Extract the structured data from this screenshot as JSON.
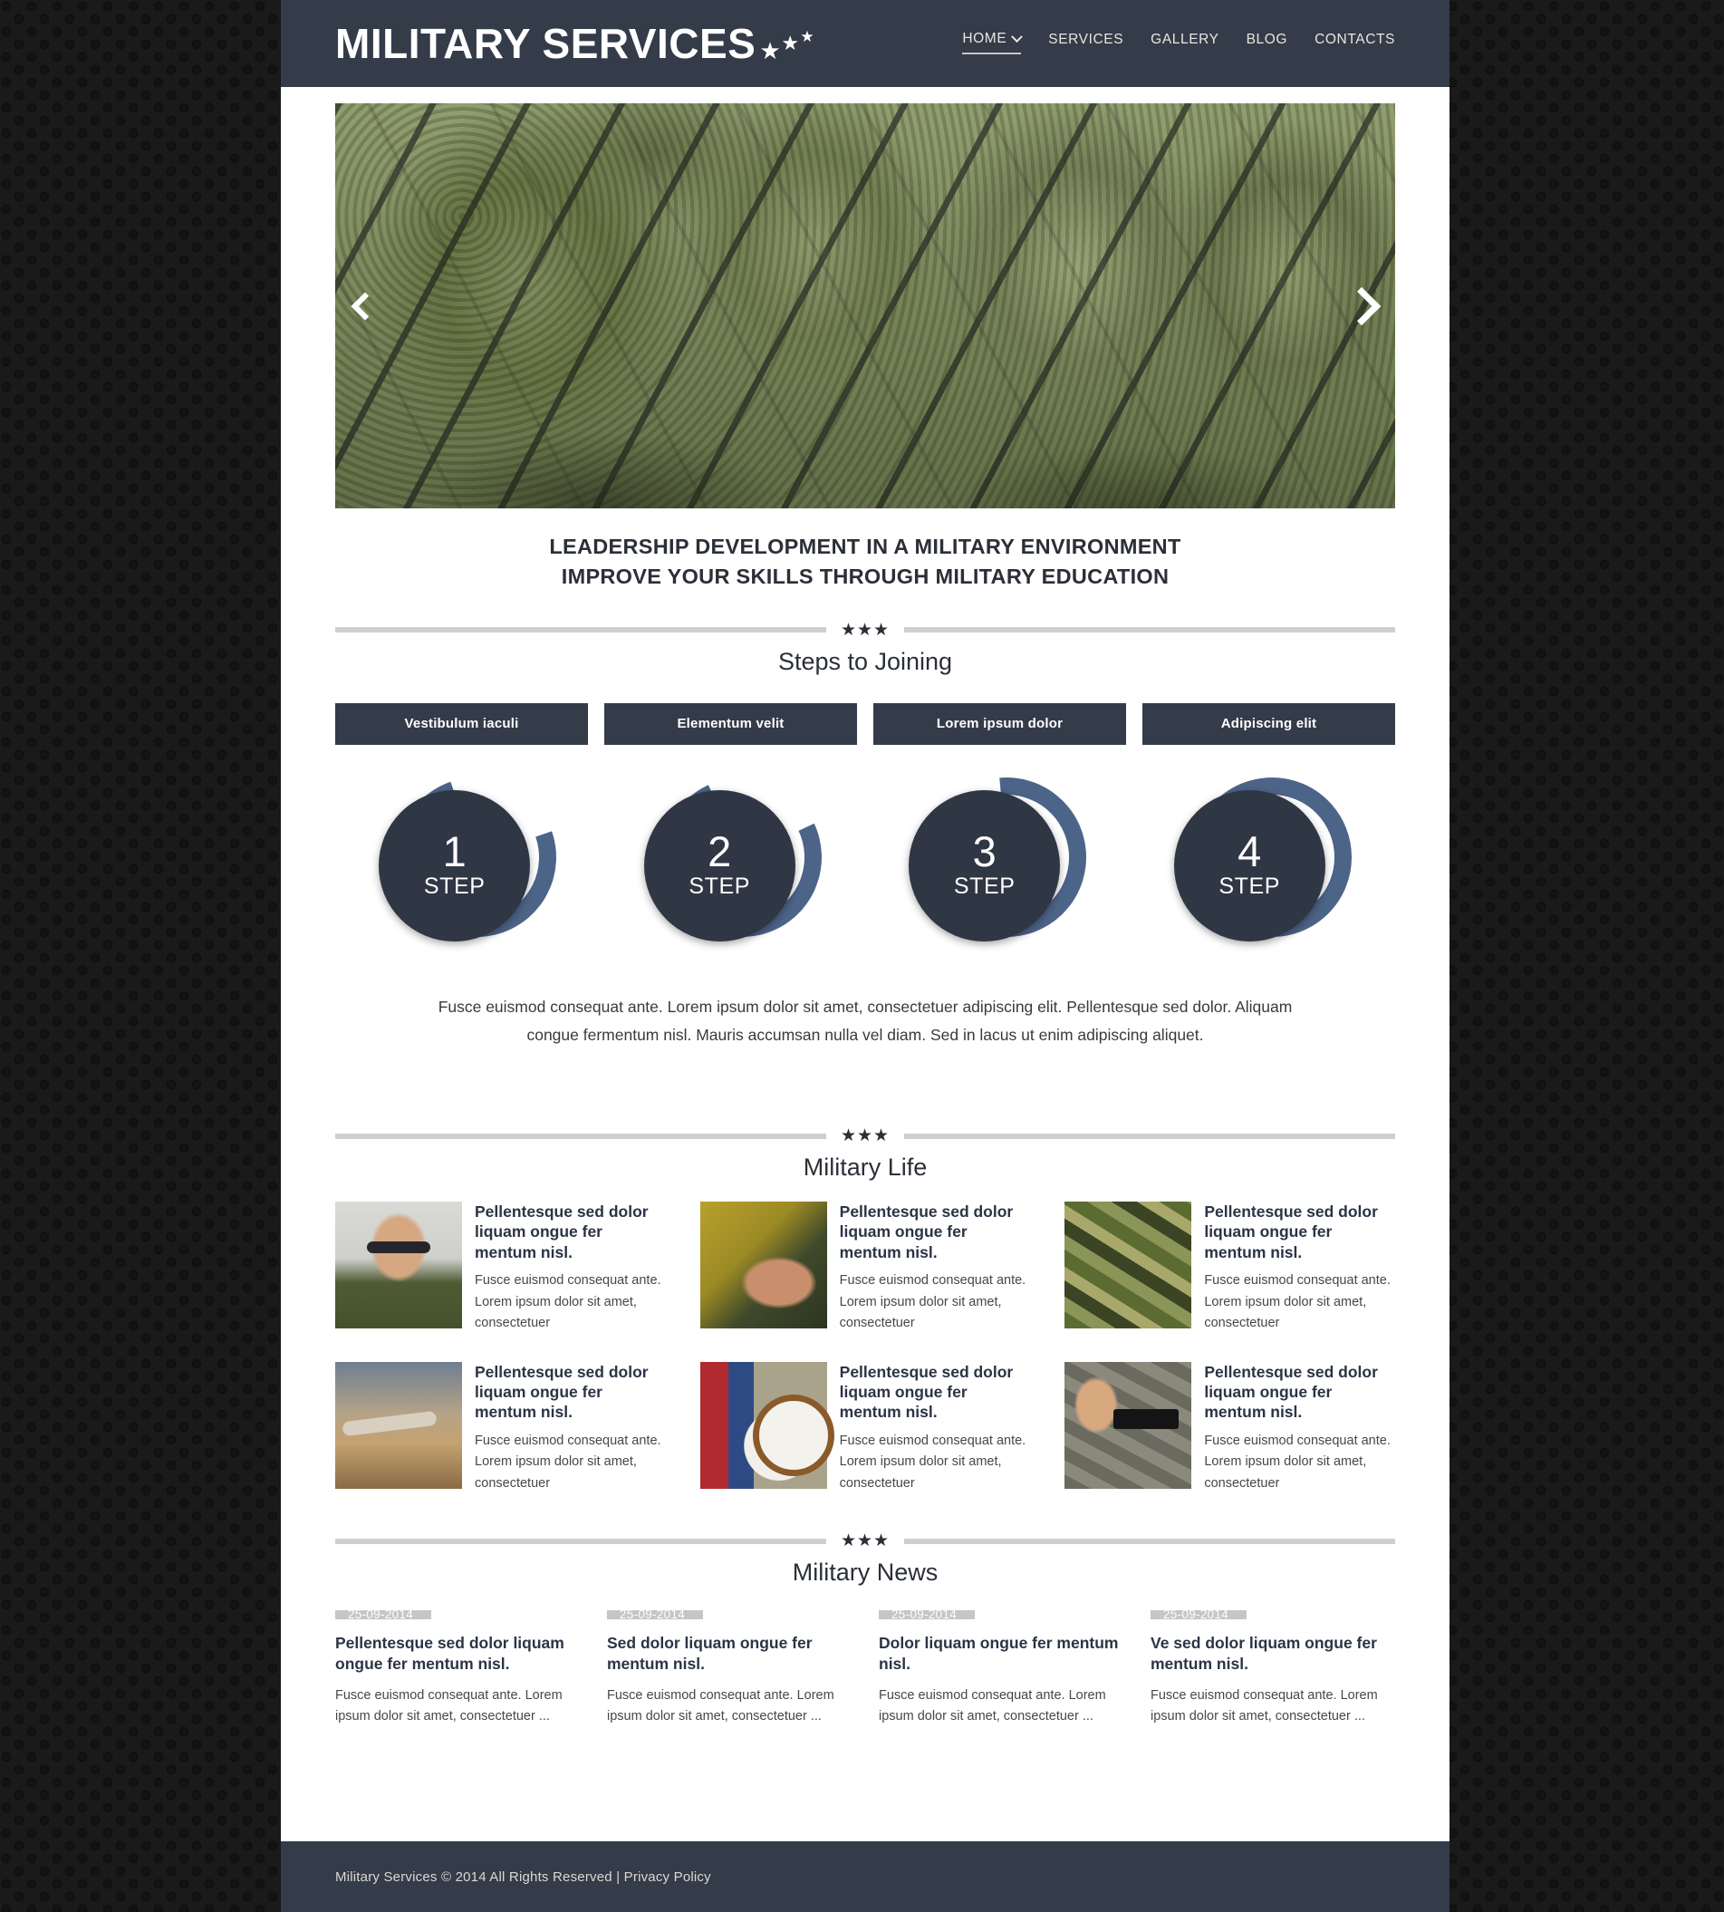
{
  "site": {
    "logo_text": "MILITARY SERVICES",
    "star_glyph": "★"
  },
  "nav": {
    "items": [
      {
        "label": "HOME",
        "active": true,
        "has_dropdown": true
      },
      {
        "label": "SERVICES",
        "active": false,
        "has_dropdown": false
      },
      {
        "label": "GALLERY",
        "active": false,
        "has_dropdown": false
      },
      {
        "label": "BLOG",
        "active": false,
        "has_dropdown": false
      },
      {
        "label": "CONTACTS",
        "active": false,
        "has_dropdown": false
      }
    ]
  },
  "slider": {
    "prev_label": "Previous slide",
    "next_label": "Next slide",
    "image_alt": "Row of soldiers in camouflage helmets holding rifles"
  },
  "tagline": {
    "line1": "LEADERSHIP DEVELOPMENT IN A MILITARY ENVIRONMENT",
    "line2": "IMPROVE YOUR SKILLS THROUGH MILITARY EDUCATION"
  },
  "steps_section": {
    "divider_stars": "★★★",
    "title": "Steps to Joining",
    "tabs": [
      {
        "label": "Vestibulum iaculi"
      },
      {
        "label": "Elementum velit"
      },
      {
        "label": "Lorem ipsum dolor"
      },
      {
        "label": "Adipiscing elit"
      }
    ],
    "circles": [
      {
        "number": "1",
        "label": "STEP"
      },
      {
        "number": "2",
        "label": "STEP"
      },
      {
        "number": "3",
        "label": "STEP"
      },
      {
        "number": "4",
        "label": "STEP"
      }
    ],
    "paragraph": "Fusce euismod consequat ante. Lorem ipsum dolor sit amet, consectetuer adipiscing elit. Pellentesque sed dolor. Aliquam congue fermentum nisl. Mauris accumsan nulla vel diam. Sed in lacus ut enim adipiscing aliquet."
  },
  "life_section": {
    "divider_stars": "★★★",
    "title": "Military Life",
    "items": [
      {
        "title": "Pellentesque sed dolor liquam ongue fer mentum nisl.",
        "text": "Fusce euismod consequat ante. Lorem ipsum dolor sit amet, consectetuer",
        "image_alt": "Man in green shirt wearing aviator sunglasses"
      },
      {
        "title": "Pellentesque sed dolor liquam ongue fer mentum nisl.",
        "text": "Fusce euismod consequat ante. Lorem ipsum dolor sit amet, consectetuer",
        "image_alt": "Soldier in camouflage cap looking down"
      },
      {
        "title": "Pellentesque sed dolor liquam ongue fer mentum nisl.",
        "text": "Fusce euismod consequat ante. Lorem ipsum dolor sit amet, consectetuer",
        "image_alt": "Close-up of woodland camouflage uniform"
      },
      {
        "title": "Pellentesque sed dolor liquam ongue fer mentum nisl.",
        "text": "Fusce euismod consequat ante. Lorem ipsum dolor sit amet, consectetuer",
        "image_alt": "Military aircraft flying at sunset"
      },
      {
        "title": "Pellentesque sed dolor liquam ongue fer mentum nisl.",
        "text": "Fusce euismod consequat ante. Lorem ipsum dolor sit amet, consectetuer",
        "image_alt": "U.S. Army soldier holding a clock in front of American flag"
      },
      {
        "title": "Pellentesque sed dolor liquam ongue fer mentum nisl.",
        "text": "Fusce euismod consequat ante. Lorem ipsum dolor sit amet, consectetuer",
        "image_alt": "Soldier in camouflage aiming a pistol"
      }
    ]
  },
  "news_section": {
    "divider_stars": "★★★",
    "title": "Military News",
    "items": [
      {
        "date": "25-09-2014",
        "title": "Pellentesque sed dolor liquam ongue fer mentum nisl.",
        "text": "Fusce euismod consequat ante. Lorem ipsum dolor sit amet, consectetuer ..."
      },
      {
        "date": "25-09-2014",
        "title": "Sed dolor liquam ongue fer mentum nisl.",
        "text": "Fusce euismod consequat ante. Lorem ipsum dolor sit amet, consectetuer ..."
      },
      {
        "date": "25-09-2014",
        "title": "Dolor liquam ongue fer mentum nisl.",
        "text": "Fusce euismod consequat ante. Lorem ipsum dolor sit amet, consectetuer ..."
      },
      {
        "date": "25-09-2014",
        "title": "Ve sed dolor liquam ongue fer mentum nisl.",
        "text": "Fusce euismod consequat ante. Lorem ipsum dolor sit amet, consectetuer ..."
      }
    ]
  },
  "footer": {
    "copyright": "Military Services © 2014 All Rights Reserved",
    "separator": "|",
    "privacy_label": "Privacy Policy"
  },
  "colors": {
    "dark_navy": "#343b49",
    "circle_fill": "#2f3644",
    "ring_blue": "#4d6489",
    "divider_gray": "#cfcfcf",
    "date_badge_gray": "#c6c6c6",
    "heading_navy": "#2b3446",
    "page_bg": "#1a1a1a"
  }
}
